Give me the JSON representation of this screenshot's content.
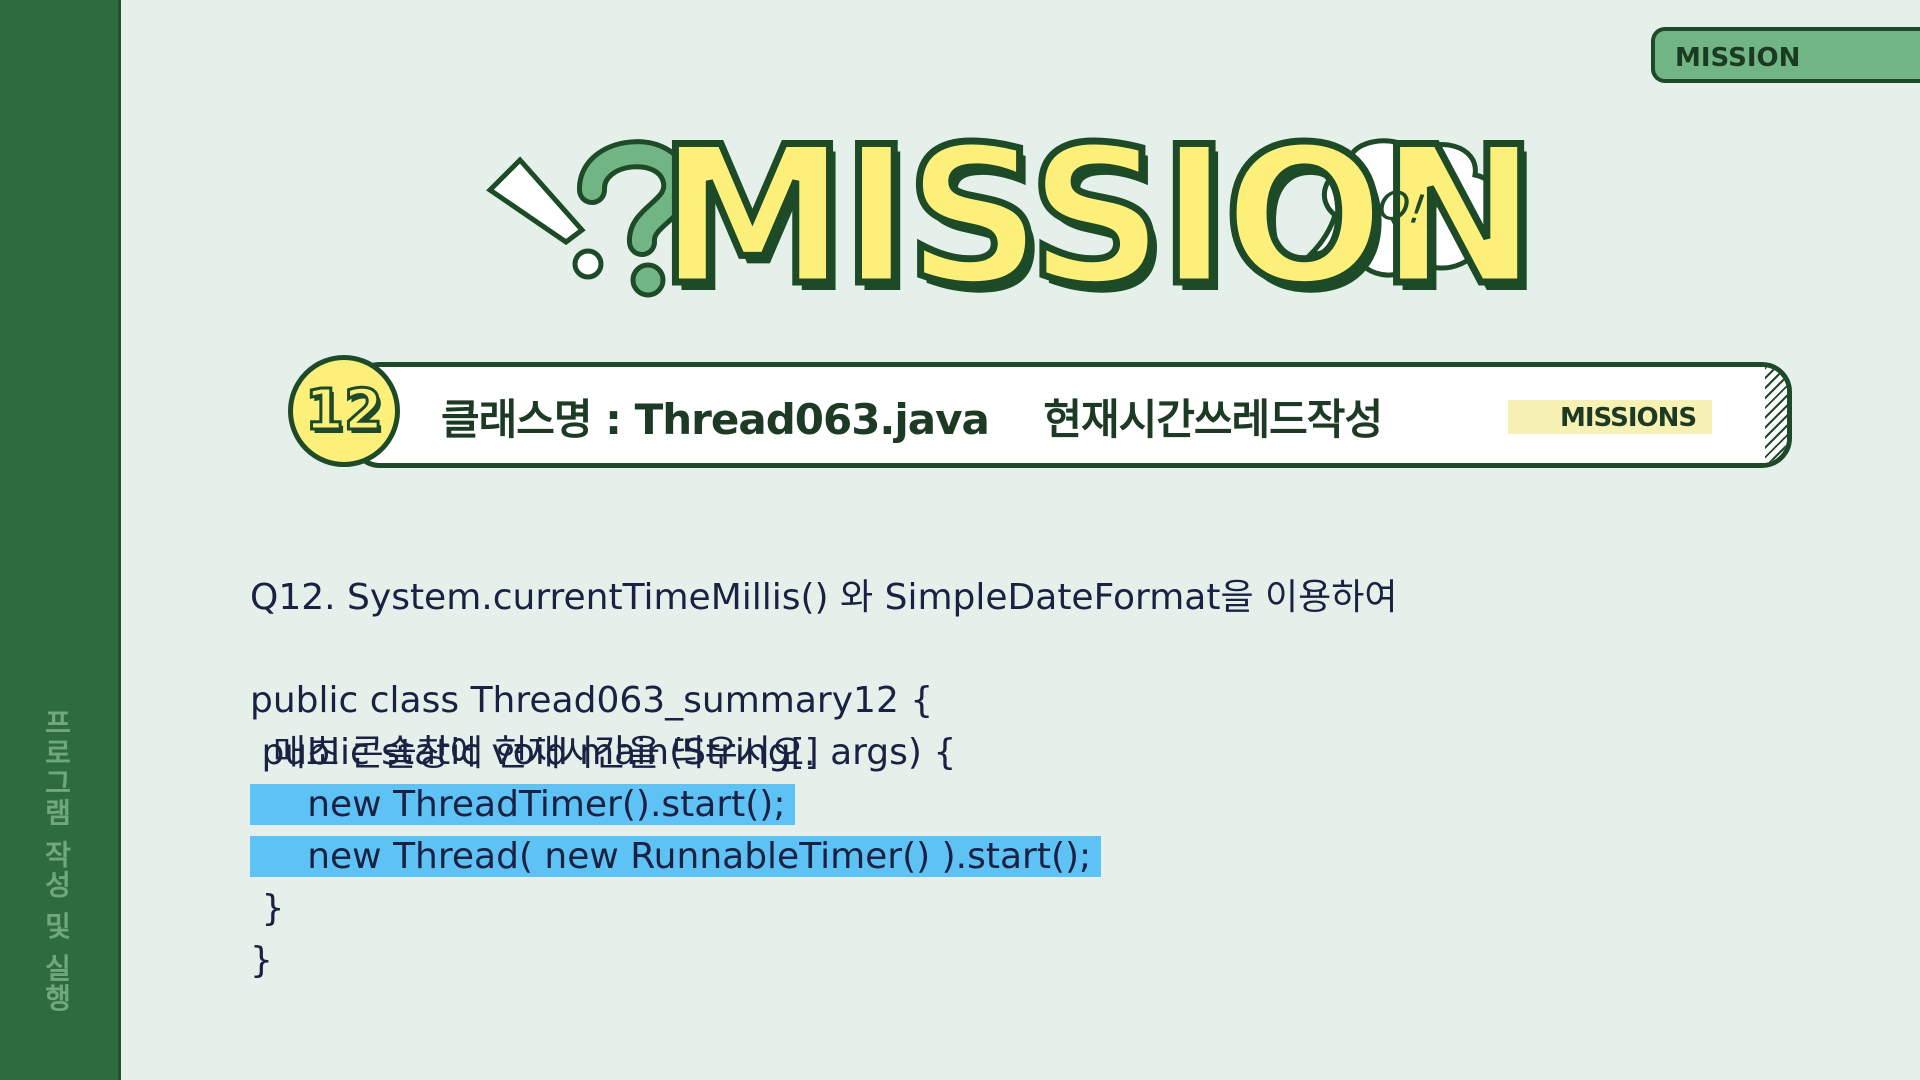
{
  "sidebar": {
    "label": "프로그램 작성 및 실행"
  },
  "corner_tag": {
    "label": "MISSION"
  },
  "headline": {
    "text": "MISSION",
    "bubble_text": "Q!!"
  },
  "title_bar": {
    "number": "12",
    "text": "클래스명 : Thread063.java    현재시간쓰레드작성",
    "tag": "MISSIONS"
  },
  "question": {
    "line1": "Q12. System.currentTimeMillis() 와 SimpleDateFormat을 이용하여",
    "line2": "  매초 콘솔창에 현재시간을 띄우시오."
  },
  "code": {
    "lines": [
      "public class Thread063_summary12 {",
      " public static void main(String[] args) {",
      "     new ThreadTimer().start();",
      "     new Thread( new RunnableTimer() ).start();",
      " }",
      "}"
    ]
  },
  "colors": {
    "sidebar": "#2e6b3d",
    "background": "#e6f0ea",
    "headline_fill": "#fdf07a",
    "outline": "#1d4a27",
    "highlight": "#5ec2f5",
    "text": "#1a2142"
  }
}
